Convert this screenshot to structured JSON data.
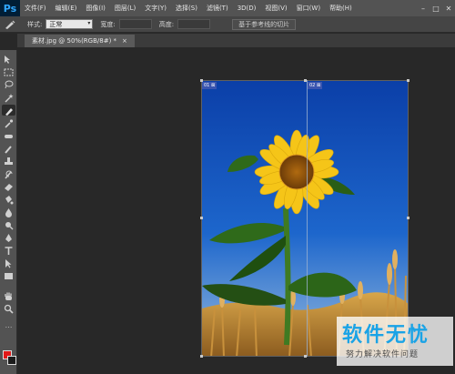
{
  "app": {
    "logo": "Ps"
  },
  "menubar": {
    "items": [
      "文件(F)",
      "编辑(E)",
      "图像(I)",
      "图层(L)",
      "文字(Y)",
      "选择(S)",
      "滤镜(T)",
      "3D(D)",
      "视图(V)",
      "窗口(W)",
      "帮助(H)"
    ],
    "win_min": "–",
    "win_max": "□",
    "win_close": "✕"
  },
  "options": {
    "style_label": "样式:",
    "style_value": "正常",
    "width_label": "宽度:",
    "height_label": "高度:",
    "button_label": "基于参考线的切片"
  },
  "document": {
    "tab_title": "素材.jpg @ 50%(RGB/8#) *",
    "tab_close": "×"
  },
  "slices": {
    "slice1": "01 ⊠",
    "slice2": "02 ⊠"
  },
  "watermark": {
    "title": "软件无忧",
    "subtitle": "努力解决软件问题"
  },
  "colors": {
    "foreground": "#e01818",
    "background": "#1c1c1c"
  }
}
